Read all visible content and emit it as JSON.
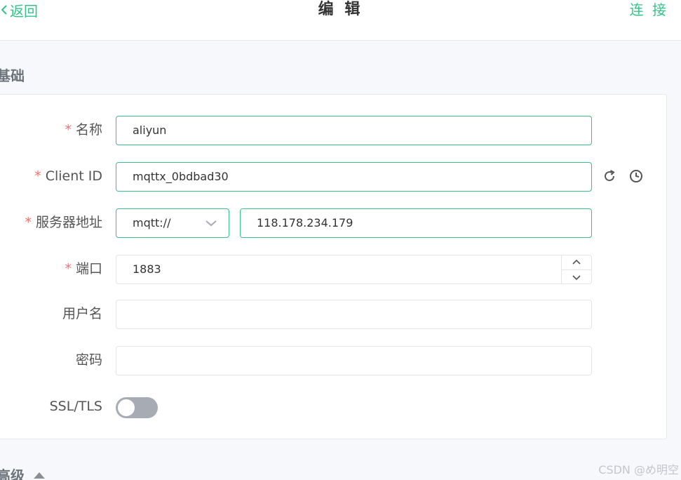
{
  "header": {
    "back_label": "返回",
    "title": "编 辑",
    "connect_label": "连 接"
  },
  "basic": {
    "section_title": "基础",
    "required_mark": "*",
    "name": {
      "label": "名称",
      "value": "aliyun"
    },
    "client_id": {
      "label": "Client ID",
      "value": "mqttx_0bdbad30"
    },
    "host": {
      "label": "服务器地址",
      "protocol": "mqtt://",
      "value": "118.178.234.179"
    },
    "port": {
      "label": "端口",
      "value": "1883"
    },
    "username": {
      "label": "用户名",
      "value": ""
    },
    "password": {
      "label": "密码",
      "value": ""
    },
    "ssl": {
      "label": "SSL/TLS",
      "enabled": false
    }
  },
  "advanced": {
    "section_title": "高级"
  },
  "watermark": "CSDN @め明空",
  "colors": {
    "accent": "#34c388",
    "required": "#f56c6c",
    "toggle_off": "#a7abb3"
  }
}
